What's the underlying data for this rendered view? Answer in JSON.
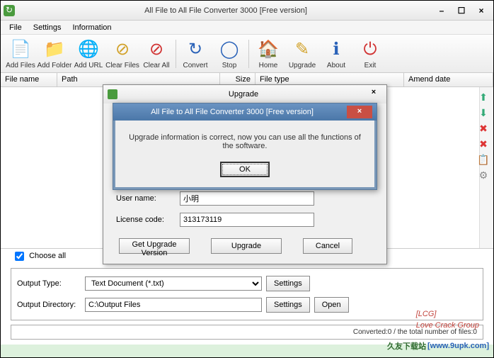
{
  "window": {
    "title": "All File to All File Converter 3000 [Free version]",
    "minimize": "–",
    "maximize": "☐",
    "close": "×"
  },
  "menu": {
    "file": "File",
    "settings": "Settings",
    "information": "Information"
  },
  "toolbar": [
    {
      "label": "Add Files",
      "glyph": "📄",
      "color": "#4a9b3e"
    },
    {
      "label": "Add Folder",
      "glyph": "📁",
      "color": "#4a9b3e"
    },
    {
      "label": "Add URL",
      "glyph": "🌐",
      "color": "#2a62b8"
    },
    {
      "label": "Clear Files",
      "glyph": "⊘",
      "color": "#d2a22a"
    },
    {
      "label": "Clear All",
      "glyph": "⊘",
      "color": "#d13333"
    },
    {
      "label": "Convert",
      "glyph": "↻",
      "color": "#2a62b8"
    },
    {
      "label": "Stop",
      "glyph": "◯",
      "color": "#2a62b8"
    },
    {
      "label": "Home",
      "glyph": "🏠",
      "color": "#d13333"
    },
    {
      "label": "Upgrade",
      "glyph": "✎",
      "color": "#d2a22a"
    },
    {
      "label": "About",
      "glyph": "ℹ",
      "color": "#2a62b8"
    },
    {
      "label": "Exit",
      "glyph": "⏻",
      "color": "#d13333"
    }
  ],
  "columns": {
    "filename": "File name",
    "path": "Path",
    "size": "Size",
    "filetype": "File type",
    "amenddate": "Amend date"
  },
  "sidebar_icons": [
    "⬆",
    "⬇",
    "✖",
    "✖",
    "📋",
    "⚙"
  ],
  "choose_all": "Choose all",
  "output": {
    "type_label": "Output Type:",
    "type_value": "Text Document (*.txt)",
    "settings": "Settings",
    "dir_label": "Output Directory:",
    "dir_value": "C:\\Output Files",
    "open": "Open"
  },
  "status": "Converted:0  /  the total number of files:0",
  "upgrade_dialog": {
    "title": "Upgrade",
    "username_label": "User name:",
    "username_value": "小明",
    "license_label": "License code:",
    "license_value": "313173119",
    "get_version": "Get Upgrade Version",
    "upgrade": "Upgrade",
    "cancel": "Cancel"
  },
  "alert": {
    "title": "All File to All File Converter 3000 [Free version]",
    "message": "Upgrade information is correct, now you can use all the functions of the software.",
    "ok": "OK"
  },
  "watermarks": {
    "lcg": "[LCG]",
    "love": "Love Crack Group",
    "site_cn": "久友下载站",
    "site_url": "[www.9upk.com]"
  }
}
